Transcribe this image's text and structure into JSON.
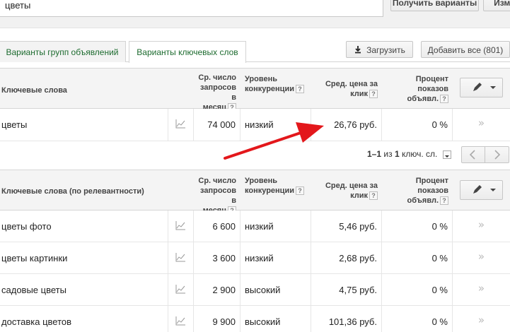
{
  "toolbar": {
    "search_value": "цветы",
    "get_ideas_label": "Получить варианты",
    "compare_label": "Изме"
  },
  "tabs": [
    {
      "label": "Варианты групп объявлений",
      "active": false
    },
    {
      "label": "Варианты ключевых слов",
      "active": true
    }
  ],
  "actions": {
    "upload_label": "Загрузить",
    "add_all_label": "Добавить все (801)"
  },
  "columns": {
    "keyword": "Ключевые слова",
    "keyword_relevance": "Ключевые слова (по релевантности)",
    "volume": [
      "Ср. число",
      "запросов в",
      "месяц"
    ],
    "competition": [
      "Уровень",
      "конкуренции"
    ],
    "cpc": [
      "Сред. цена за",
      "клик"
    ],
    "share": [
      "Процент",
      "показов",
      "объявл."
    ],
    "help": "?"
  },
  "search_terms": [
    {
      "keyword": "цветы",
      "volume": "74 000",
      "competition": "низкий",
      "cpc": "26,76 руб.",
      "share": "0 %"
    }
  ],
  "pager": {
    "range": "1–1",
    "of_label": "из",
    "total": "1",
    "unit": "ключ. сл."
  },
  "ideas": [
    {
      "keyword": "цветы фото",
      "volume": "6 600",
      "competition": "низкий",
      "cpc": "5,46 руб.",
      "share": "0 %"
    },
    {
      "keyword": "цветы картинки",
      "volume": "3 600",
      "competition": "низкий",
      "cpc": "2,68 руб.",
      "share": "0 %"
    },
    {
      "keyword": "садовые цветы",
      "volume": "2 900",
      "competition": "высокий",
      "cpc": "4,75 руб.",
      "share": "0 %"
    },
    {
      "keyword": "доставка цветов",
      "volume": "9 900",
      "competition": "высокий",
      "cpc": "101,36 руб.",
      "share": "0 %"
    }
  ],
  "icons": {
    "trend": "chart-line-icon",
    "add": "double-chevron-right-icon",
    "edit": "pencil-icon",
    "download": "download-icon"
  },
  "colors": {
    "tab_text": "#1d6b2f",
    "arrow": "#e3171b"
  }
}
